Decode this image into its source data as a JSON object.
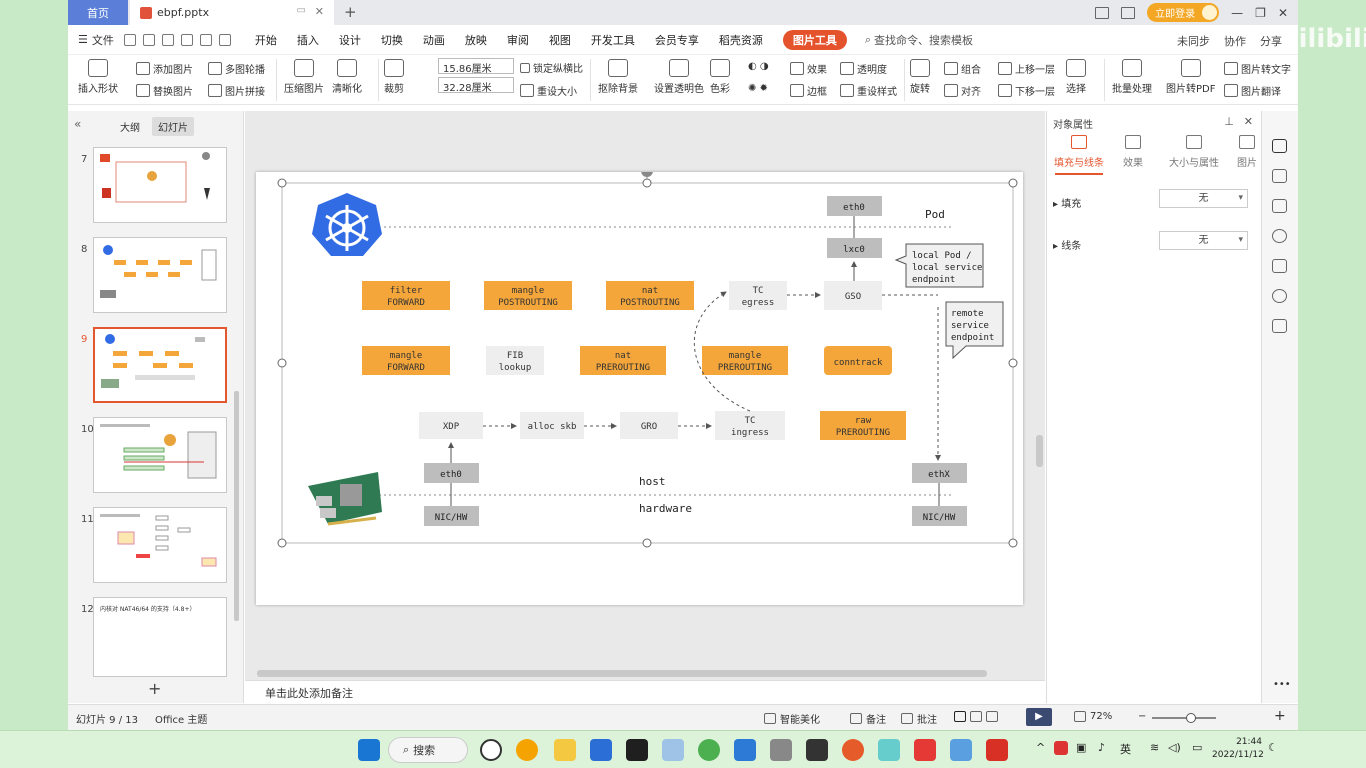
{
  "titlebar": {
    "home_tab": "首页",
    "doc_tab": "ebpf.pptx",
    "login": "立即登录"
  },
  "menubar": {
    "file": "文件",
    "items": [
      "开始",
      "插入",
      "设计",
      "切换",
      "动画",
      "放映",
      "审阅",
      "视图",
      "开发工具",
      "会员专享",
      "稻壳资源"
    ],
    "active": "图片工具",
    "search": "查找命令、搜索模板",
    "sync": "未同步",
    "collab": "协作",
    "share": "分享"
  },
  "ribbon": {
    "insert_shape": "插入形状",
    "add_picture": "添加图片",
    "replace_picture": "替换图片",
    "multi_carousel": "多图轮播",
    "picture_stitch": "图片拼接",
    "compress": "压缩图片",
    "sharpen": "清晰化",
    "crop": "裁剪",
    "width": "15.86厘米",
    "height": "32.28厘米",
    "lock_ratio": "锁定纵横比",
    "reset_size": "重设大小",
    "remove_bg": "抠除背景",
    "set_transparent": "设置透明色",
    "color": "色彩",
    "effect": "效果",
    "transparency": "透明度",
    "border": "边框",
    "reset_style": "重设样式",
    "rotate": "旋转",
    "group": "组合",
    "align": "对齐",
    "bring_forward": "上移一层",
    "send_backward": "下移一层",
    "select": "选择",
    "batch": "批量处理",
    "to_pdf": "图片转PDF",
    "to_text": "图片转文字",
    "translate": "图片翻译"
  },
  "left_panel": {
    "outline_tab": "大纲",
    "slides_tab": "幻灯片",
    "slides": [
      {
        "num": "7"
      },
      {
        "num": "8"
      },
      {
        "num": "9"
      },
      {
        "num": "10"
      },
      {
        "num": "11"
      },
      {
        "num": "12",
        "caption": "内核对 NAT46/64 的支持（4.8+）"
      }
    ],
    "add": "+"
  },
  "notes": {
    "placeholder": "单击此处添加备注"
  },
  "right_panel": {
    "title": "对象属性",
    "tabs": [
      "填充与线条",
      "效果",
      "大小与属性",
      "图片"
    ],
    "fill_label": "填充",
    "fill_value": "无",
    "line_label": "线条",
    "line_value": "无"
  },
  "statusbar": {
    "slide_pos": "幻灯片 9 / 13",
    "theme": "Office 主题",
    "beautify": "智能美化",
    "notes": "备注",
    "comments": "批注",
    "zoom": "72%"
  },
  "taskbar": {
    "search": "搜索",
    "ime": "英",
    "time": "21:44",
    "date": "2022/11/12"
  },
  "watermark": "bilibili",
  "diagram": {
    "pod": "Pod",
    "eth0_top": "eth0",
    "lxc0": "lxc0",
    "host": "host",
    "hardware": "hardware",
    "local_note": [
      "local Pod /",
      "local service",
      "endpoint"
    ],
    "remote_note": [
      "remote",
      "service",
      "endpoint"
    ],
    "orange": [
      [
        "filter",
        "FORWARD"
      ],
      [
        "mangle",
        "POSTROUTING"
      ],
      [
        "nat",
        "POSTROUTING"
      ],
      [
        "mangle",
        "FORWARD"
      ],
      [
        "nat",
        "PREROUTING"
      ],
      [
        "mangle",
        "PREROUTING"
      ],
      [
        "conntrack"
      ],
      [
        "raw",
        "PREROUTING"
      ]
    ],
    "gray": [
      [
        "FIB",
        "lookup"
      ],
      [
        "TC",
        "egress"
      ],
      [
        "GSO"
      ],
      [
        "XDP"
      ],
      [
        "alloc skb"
      ],
      [
        "GRO"
      ],
      [
        "TC",
        "ingress"
      ]
    ],
    "dark": [
      "eth0",
      "NIC/HW",
      "ethX",
      "NIC/HW"
    ]
  }
}
